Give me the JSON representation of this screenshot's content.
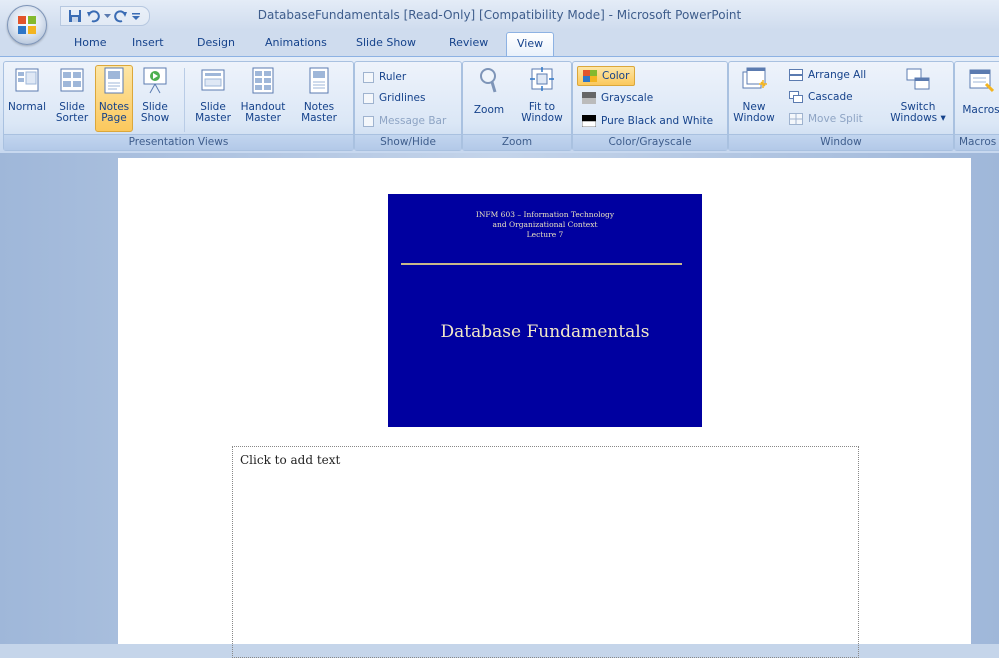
{
  "window": {
    "title": "DatabaseFundamentals [Read-Only] [Compatibility Mode] - Microsoft PowerPoint"
  },
  "quick_access": [
    "save-icon",
    "undo-icon",
    "redo-icon",
    "customize-icon"
  ],
  "tabs": [
    {
      "label": "Home"
    },
    {
      "label": "Insert"
    },
    {
      "label": "Design"
    },
    {
      "label": "Animations"
    },
    {
      "label": "Slide Show"
    },
    {
      "label": "Review"
    },
    {
      "label": "View"
    }
  ],
  "active_tab": "View",
  "ribbon": {
    "presentation_views": {
      "label": "Presentation Views",
      "normal": "Normal",
      "slide_sorter_1": "Slide",
      "slide_sorter_2": "Sorter",
      "notes_page_1": "Notes",
      "notes_page_2": "Page",
      "slide_show_1": "Slide",
      "slide_show_2": "Show",
      "slide_master_1": "Slide",
      "slide_master_2": "Master",
      "handout_master_1": "Handout",
      "handout_master_2": "Master",
      "notes_master_1": "Notes",
      "notes_master_2": "Master"
    },
    "show_hide": {
      "label": "Show/Hide",
      "ruler": "Ruler",
      "gridlines": "Gridlines",
      "message_bar": "Message Bar"
    },
    "zoom": {
      "label": "Zoom",
      "zoom": "Zoom",
      "fit_1": "Fit to",
      "fit_2": "Window"
    },
    "color": {
      "label": "Color/Grayscale",
      "color": "Color",
      "grayscale": "Grayscale",
      "pure": "Pure Black and White"
    },
    "window": {
      "label": "Window",
      "new_1": "New",
      "new_2": "Window",
      "arrange_all": "Arrange All",
      "cascade": "Cascade",
      "move_split": "Move Split",
      "switch_1": "Switch",
      "switch_2": "Windows"
    },
    "macros": {
      "label": "Macros",
      "macros": "Macros"
    }
  },
  "slide": {
    "subtitle_1": "INFM 603 – Information Technology",
    "subtitle_2": "and Organizational Context",
    "subtitle_3": "Lecture 7",
    "title": "Database Fundamentals"
  },
  "notes": {
    "placeholder": "Click to add text"
  },
  "colors": {
    "slide_bg": "#0000a0",
    "ribbon_accent": "#15428b",
    "selected": "#fbc85d"
  }
}
